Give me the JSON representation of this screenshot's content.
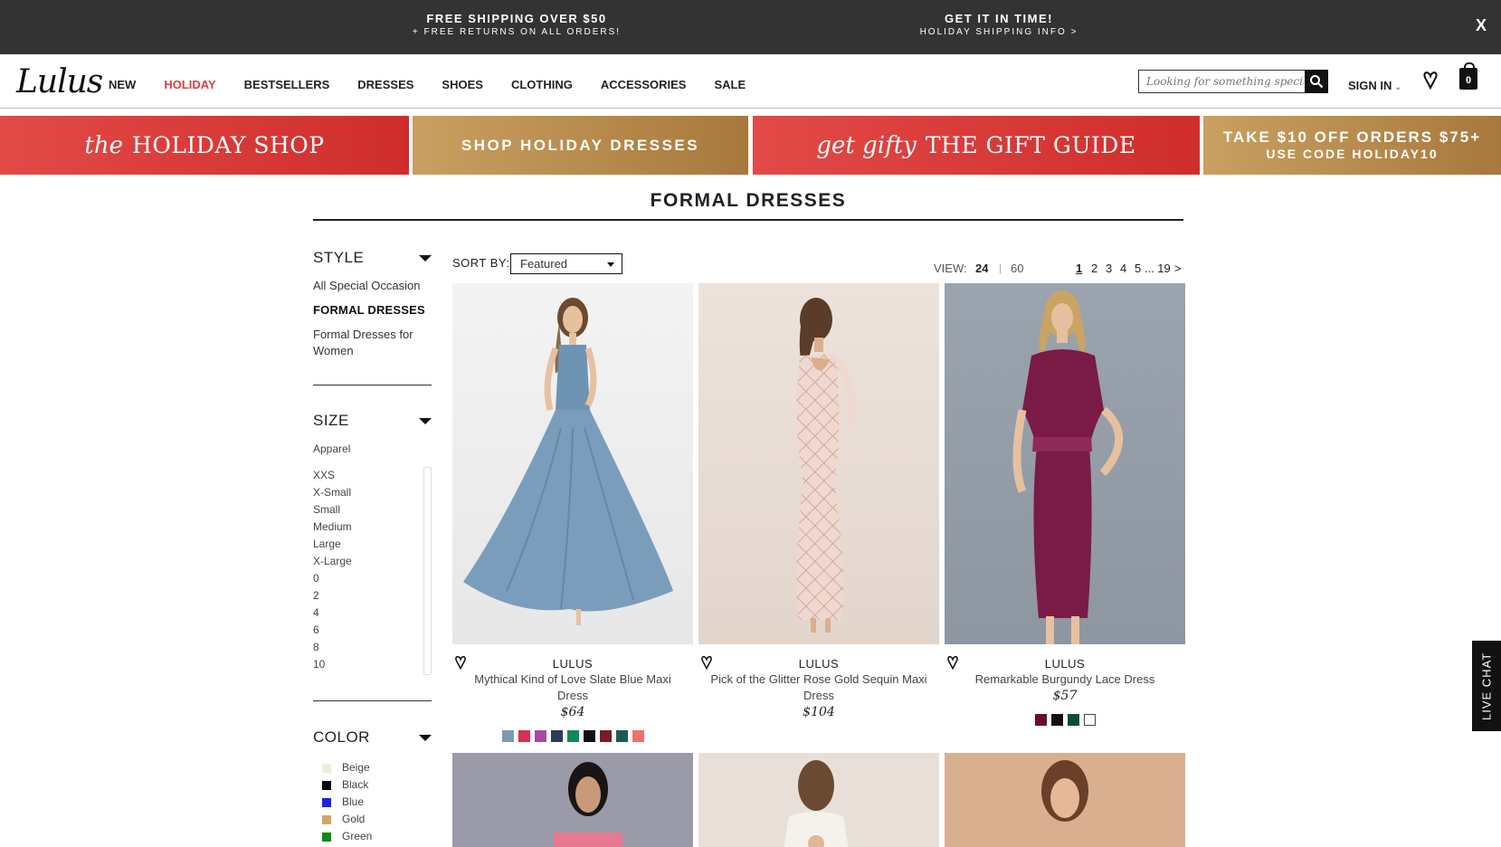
{
  "promo": {
    "left_line1": "FREE SHIPPING OVER $50",
    "left_line2": "+ FREE RETURNS ON ALL ORDERS!",
    "right_line1": "GET IT IN TIME!",
    "right_line2": "HOLIDAY SHIPPING INFO >",
    "close": "X"
  },
  "header": {
    "logo": "Lulus",
    "nav": [
      "NEW",
      "HOLIDAY",
      "BESTSELLERS",
      "DRESSES",
      "SHOES",
      "CLOTHING",
      "ACCESSORIES",
      "SALE"
    ],
    "active_nav": "HOLIDAY",
    "search_placeholder": "Looking for something special?",
    "sign_in": "SIGN IN",
    "bag_count": "0"
  },
  "banners": {
    "b1_script": "the",
    "b1_main": "HOLIDAY SHOP",
    "b2": "SHOP HOLIDAY DRESSES",
    "b3_script": "get gifty",
    "b3_main": "THE GIFT GUIDE",
    "b4_line1": "TAKE $10 OFF ORDERS $75+",
    "b4_line2": "USE CODE HOLIDAY10"
  },
  "page_title": "FORMAL DRESSES",
  "sidebar": {
    "style_label": "STYLE",
    "style_links": [
      "All Special Occasion",
      "FORMAL DRESSES",
      "Formal Dresses for Women"
    ],
    "size_label": "SIZE",
    "size_group": "Apparel",
    "sizes": [
      "XXS",
      "X-Small",
      "Small",
      "Medium",
      "Large",
      "X-Large",
      "0",
      "2",
      "4",
      "6",
      "8",
      "10"
    ],
    "color_label": "COLOR",
    "colors": [
      {
        "name": "Beige",
        "hex": "#f1ecd6"
      },
      {
        "name": "Black",
        "hex": "#000000"
      },
      {
        "name": "Blue",
        "hex": "#1f1fe6"
      },
      {
        "name": "Gold",
        "hex": "#d4a562"
      },
      {
        "name": "Green",
        "hex": "#108a10"
      }
    ]
  },
  "toolbar": {
    "sort_label": "SORT BY:",
    "sort_value": "Featured",
    "view_label": "VIEW:",
    "view_24": "24",
    "view_sep": "|",
    "view_60": "60",
    "pages": [
      "1",
      "2",
      "3",
      "4",
      "5 ... 19",
      ">"
    ]
  },
  "products": [
    {
      "brand": "LULUS",
      "name": "Mythical Kind of Love Slate Blue Maxi Dress",
      "price": "$64",
      "swatches": [
        "#7b9bb5",
        "#d6304f",
        "#a94aa0",
        "#2a3a5c",
        "#0f8a5a",
        "#111111",
        "#7a1a2a",
        "#1f5a4a",
        "#f07070"
      ]
    },
    {
      "brand": "LULUS",
      "name": "Pick of the Glitter Rose Gold Sequin Maxi Dress",
      "price": "$104",
      "swatches": []
    },
    {
      "brand": "LULUS",
      "name": "Remarkable Burgundy Lace Dress",
      "price": "$57",
      "swatches": [
        "#6a0e2a",
        "#111111",
        "#0d4a3a",
        "#ffffff"
      ]
    }
  ],
  "live_chat": "LIVE CHAT"
}
